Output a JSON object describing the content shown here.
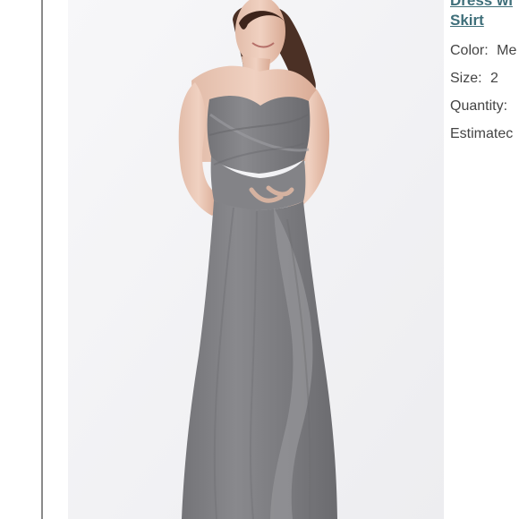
{
  "product": {
    "title_line_1": "Dress wi",
    "title_line_2": "Skirt",
    "color_label": "Color:",
    "color_value": "Me",
    "size_label": "Size:",
    "size_value": "2",
    "quantity_label": "Quantity:",
    "quantity_value": "",
    "estimated_label": "Estimatec"
  },
  "colors": {
    "title": "#3f6f7a",
    "text": "#444444",
    "dress": "#7f7f83",
    "background": "#f4f4f6"
  }
}
